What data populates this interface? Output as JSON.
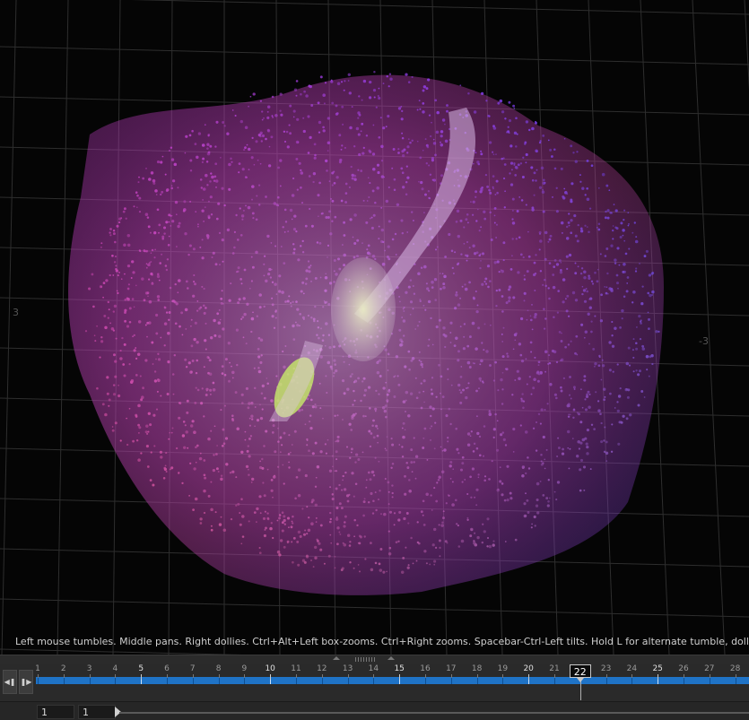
{
  "viewport": {
    "hint": "Left mouse tumbles. Middle pans. Right dollies. Ctrl+Alt+Left box-zooms. Ctrl+Right zooms. Spacebar-Ctrl-Left tilts. Hold L for alternate tumble, dolly, and zoom.",
    "axis_labels": {
      "left": "3",
      "right": "-3"
    }
  },
  "timeline": {
    "frames": [
      "1",
      "2",
      "3",
      "4",
      "5",
      "6",
      "7",
      "8",
      "9",
      "10",
      "11",
      "12",
      "13",
      "14",
      "15",
      "16",
      "17",
      "18",
      "19",
      "20",
      "21",
      "22",
      "23",
      "24",
      "25",
      "26",
      "27",
      "28"
    ],
    "major_frames": [
      "5",
      "10",
      "15",
      "20",
      "25"
    ],
    "current_frame": "22",
    "track_color": "#1f73c6"
  },
  "range": {
    "start": "1",
    "end": "1"
  },
  "icons": {
    "prev": "step-back-icon",
    "next": "step-forward-icon"
  }
}
